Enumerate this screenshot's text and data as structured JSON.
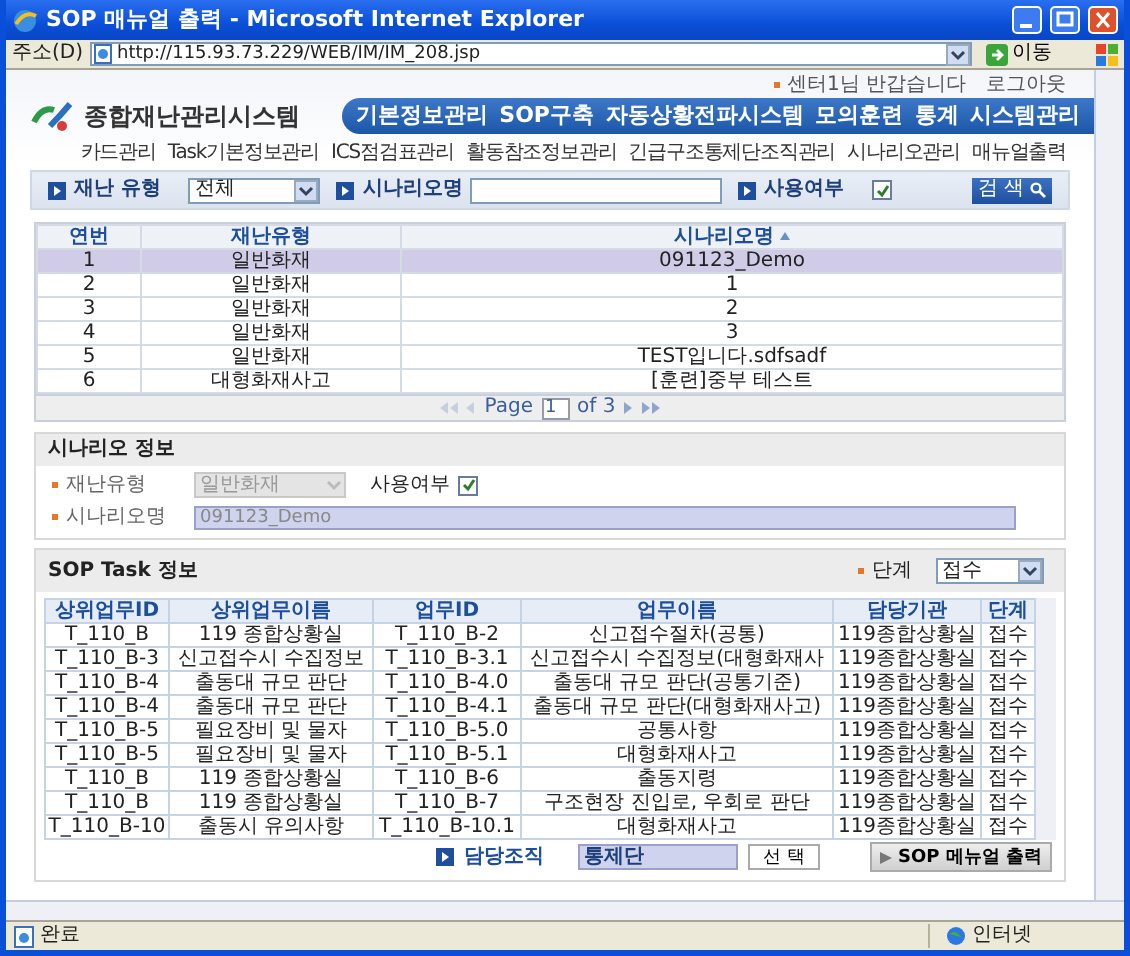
{
  "window": {
    "title": "SOP 매뉴얼 출력 - Microsoft Internet Explorer"
  },
  "address_bar": {
    "label": "주소(D)",
    "url": "http://115.93.73.229/WEB/IM/IM_208.jsp",
    "go": "이동"
  },
  "header": {
    "top_links": [
      "센터1님 반갑습니다",
      "로그아웃"
    ],
    "logo": "종합재난관리시스템",
    "nav": [
      "기본정보관리",
      "SOP구축",
      "자동상황전파시스템",
      "모의훈련",
      "통계",
      "시스템관리"
    ],
    "submenu": [
      "카드관리",
      "Task기본정보관리",
      "ICS점검표관리",
      "활동참조정보관리",
      "긴급구조통제단조직관리",
      "시나리오관리",
      "매뉴얼출력"
    ]
  },
  "search": {
    "type_label": "재난 유형",
    "type_value": "전체",
    "name_label": "시나리오명",
    "use_label": "사용여부",
    "use_checked": true,
    "button": "검 색"
  },
  "scenario_table": {
    "columns": [
      "연번",
      "재난유형",
      "시나리오명"
    ],
    "rows": [
      {
        "cells": [
          "1",
          "일반화재",
          "091123_Demo"
        ],
        "selected": true
      },
      {
        "cells": [
          "2",
          "일반화재",
          "1"
        ],
        "selected": false
      },
      {
        "cells": [
          "3",
          "일반화재",
          "2"
        ],
        "selected": false
      },
      {
        "cells": [
          "4",
          "일반화재",
          "3"
        ],
        "selected": false
      },
      {
        "cells": [
          "5",
          "일반화재",
          "TEST입니다.sdfsadf"
        ],
        "selected": false
      },
      {
        "cells": [
          "6",
          "대형화재사고",
          "[훈련]중부 테스트"
        ],
        "selected": false
      }
    ],
    "pager": {
      "label": "Page",
      "page": "1",
      "total": "of 3"
    }
  },
  "scenario_info": {
    "title": "시나리오 정보",
    "type_label": "재난유형",
    "type_value": "일반화재",
    "type_disabled": true,
    "use_label": "사용여부",
    "use_checked": true,
    "name_label": "시나리오명",
    "name_value": "091123_Demo"
  },
  "sop_task": {
    "title": "SOP Task 정보",
    "stage_label": "단계",
    "stage_value": "접수",
    "columns": [
      "상위업무ID",
      "상위업무이름",
      "업무ID",
      "업무이름",
      "담당기관",
      "단계"
    ],
    "rows": [
      [
        "T_110_B",
        "119 종합상황실",
        "T_110_B-2",
        "신고접수절차(공통)",
        "119종합상황실",
        "접수"
      ],
      [
        "T_110_B-3",
        "신고접수시 수집정보",
        "T_110_B-3.1",
        "신고접수시 수집정보(대형화재사",
        "119종합상황실",
        "접수"
      ],
      [
        "T_110_B-4",
        "출동대 규모 판단",
        "T_110_B-4.0",
        "출동대 규모 판단(공통기준)",
        "119종합상황실",
        "접수"
      ],
      [
        "T_110_B-4",
        "출동대 규모 판단",
        "T_110_B-4.1",
        "출동대 규모 판단(대형화재사고)",
        "119종합상황실",
        "접수"
      ],
      [
        "T_110_B-5",
        "필요장비 및 물자",
        "T_110_B-5.0",
        "공통사항",
        "119종합상황실",
        "접수"
      ],
      [
        "T_110_B-5",
        "필요장비 및 물자",
        "T_110_B-5.1",
        "대형화재사고",
        "119종합상황실",
        "접수"
      ],
      [
        "T_110_B",
        "119 종합상황실",
        "T_110_B-6",
        "출동지령",
        "119종합상황실",
        "접수"
      ],
      [
        "T_110_B",
        "119 종합상황실",
        "T_110_B-7",
        "구조현장 진입로, 우회로 판단",
        "119종합상황실",
        "접수"
      ],
      [
        "T_110_B-10",
        "출동시 유의사항",
        "T_110_B-10.1",
        "대형화재사고",
        "119종합상황실",
        "접수"
      ]
    ],
    "org_label": "담당조직",
    "org_value": "통제단",
    "select_button": "선 택",
    "print_button": "SOP 메뉴얼 출력"
  },
  "status_bar": {
    "text": "완료",
    "zone": "인터넷"
  }
}
